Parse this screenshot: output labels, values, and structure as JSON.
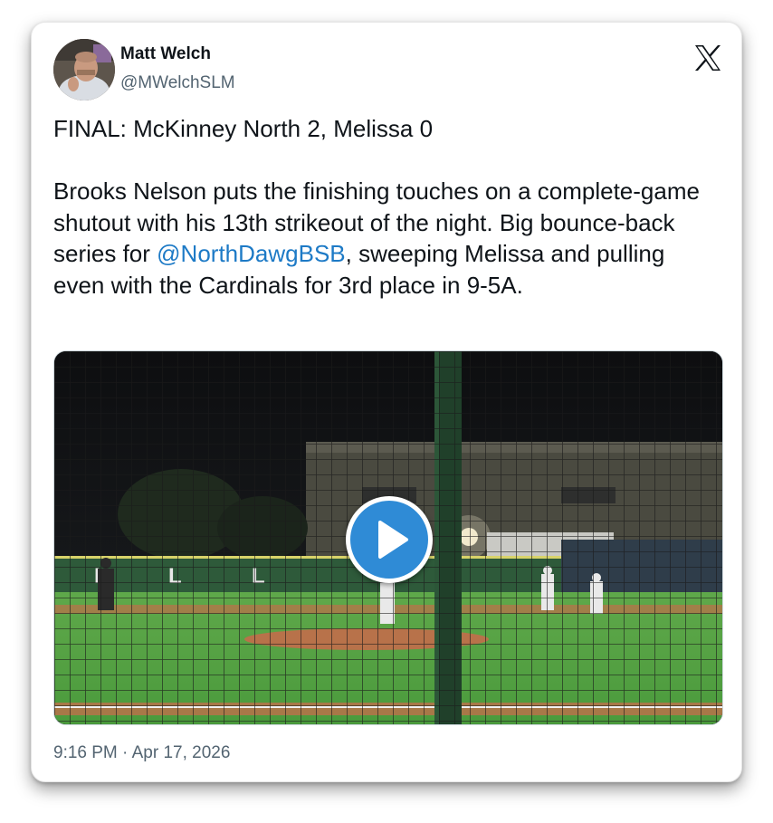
{
  "tweet": {
    "author_name": "Matt Welch",
    "author_handle": "@MWelchSLM",
    "text_line1": "FINAL: McKinney North 2, Melissa 0",
    "text_pre": "Brooks Nelson puts the finishing touches on a complete-game shutout with his 13th strikeout of the night. Big bounce-back series for ",
    "mention": "@NorthDawgBSB",
    "text_post": ", sweeping Melissa and pulling even with the Cardinals for 3rd place in 9-5A.",
    "timestamp": "9:16 PM · Apr 17, 2026"
  },
  "media": {
    "type": "video",
    "outfield_wall_letters": [
      "L",
      "L",
      "L"
    ]
  },
  "icons": {
    "platform": "x-logo-icon",
    "play": "play-icon"
  },
  "colors": {
    "text": "#0f1419",
    "secondary": "#536471",
    "link": "#1d7ac6",
    "play_button": "#2f8bd6"
  }
}
